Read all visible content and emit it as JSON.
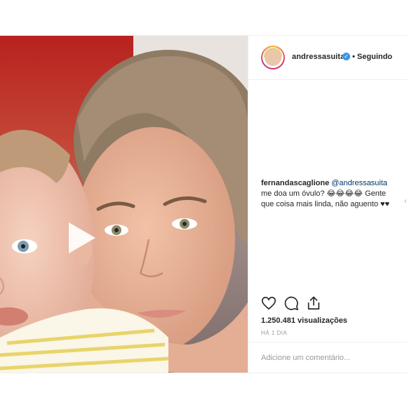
{
  "post": {
    "username": "andressasuita",
    "verified": true,
    "separator": "•",
    "follow_status": "Seguindo",
    "comment": {
      "user": "fernandascaglione",
      "mention": "@andressasuita",
      "text": "me doa um óvulo? 😂😂😂😂 Gente que coisa mais linda, não aguento ♥♥"
    },
    "views": "1.250.481 visualizações",
    "timestamp": "HÁ 1 DIA",
    "add_comment_placeholder": "Adicione um comentário..."
  },
  "icons": {
    "play": "play-icon",
    "like": "heart-icon",
    "comment": "comment-icon",
    "share": "share-icon",
    "verified": "verified-badge-icon"
  },
  "colors": {
    "verified": "#3897f0",
    "text": "#262626",
    "muted": "#999999",
    "mention": "#003569"
  }
}
